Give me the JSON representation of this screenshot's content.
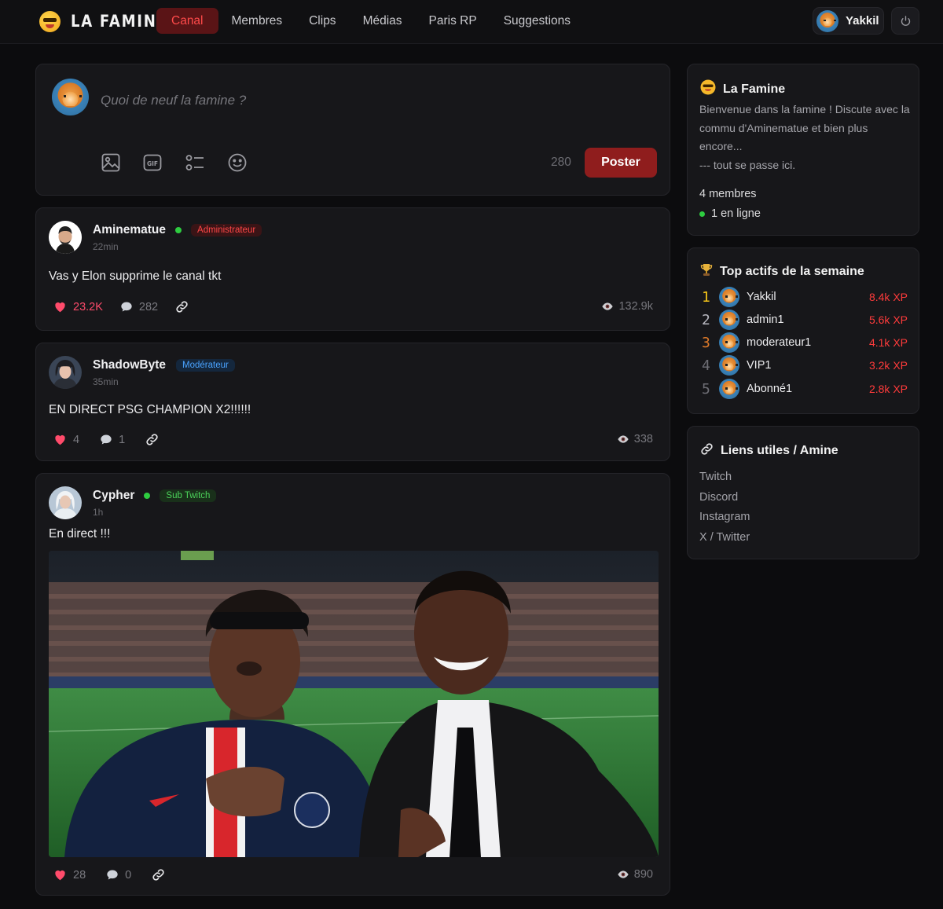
{
  "brand": {
    "name": "LA FAMINE"
  },
  "nav": {
    "items": [
      {
        "label": "Canal",
        "active": true
      },
      {
        "label": "Membres"
      },
      {
        "label": "Clips"
      },
      {
        "label": "Médias"
      },
      {
        "label": "Paris RP"
      },
      {
        "label": "Suggestions"
      }
    ]
  },
  "user": {
    "name": "Yakkil"
  },
  "composer": {
    "placeholder": "Quoi de neuf la famine ?",
    "char_count": "280",
    "post_label": "Poster",
    "tools": [
      "image-icon",
      "gif-icon",
      "poll-icon",
      "emoji-icon"
    ]
  },
  "posts": [
    {
      "author": "Aminematue",
      "online": true,
      "badge": "Administrateur",
      "time": "22min",
      "text": "Vas y Elon supprime le canal tkt",
      "likes": "23.2K",
      "liked": true,
      "comments": "282",
      "views": "132.9k"
    },
    {
      "author": "ShadowByte",
      "online": false,
      "badge": "Modérateur",
      "time": "35min",
      "text": "EN DIRECT PSG CHAMPION X2!!!!!!",
      "likes": "4",
      "liked": false,
      "comments": "1",
      "views": "338"
    },
    {
      "author": "Cypher",
      "online": true,
      "badge": "Sub Twitch",
      "time": "1h",
      "text": "En direct !!!",
      "likes": "28",
      "liked": false,
      "comments": "0",
      "views": "890",
      "has_image": true
    }
  ],
  "sidebar": {
    "about": {
      "title": "La Famine",
      "description": "Bienvenue dans la famine ! Discute avec la commu d'Aminematue et bien plus encore...",
      "description2": "--- tout se passe ici.",
      "members": "4 membres",
      "online": "1 en ligne"
    },
    "top": {
      "title": "Top actifs de la semaine",
      "rows": [
        {
          "rank": "1",
          "name": "Yakkil",
          "xp": "8.4k XP"
        },
        {
          "rank": "2",
          "name": "admin1",
          "xp": "5.6k XP"
        },
        {
          "rank": "3",
          "name": "moderateur1",
          "xp": "4.1k XP"
        },
        {
          "rank": "4",
          "name": "VIP1",
          "xp": "3.2k XP"
        },
        {
          "rank": "5",
          "name": "Abonné1",
          "xp": "2.8k XP"
        }
      ]
    },
    "links": {
      "title": "Liens utiles / Amine",
      "items": [
        "Twitch",
        "Discord",
        "Instagram",
        "X / Twitter"
      ]
    }
  },
  "colors": {
    "accent": "#ff4a4a",
    "accent_bg": "#8f1d1d",
    "online": "#2ecc40"
  }
}
